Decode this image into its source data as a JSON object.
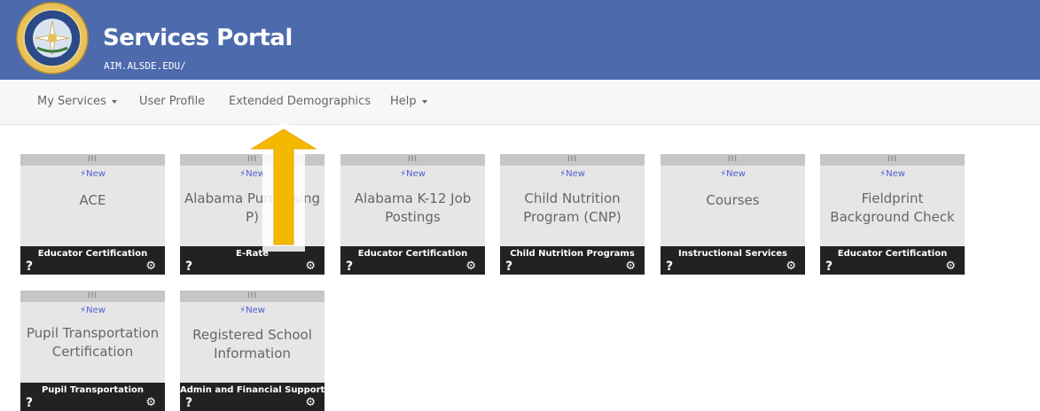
{
  "header": {
    "title": "Services Portal",
    "subtitle": "AIM.ALSDE.EDU/",
    "logo_icon": "alabama-state-department-of-education-seal",
    "bg_color": "#4d6aad"
  },
  "nav": {
    "items": [
      {
        "label": "My Services",
        "dropdown": true
      },
      {
        "label": "User Profile",
        "dropdown": false
      },
      {
        "label": "Extended Demographics",
        "dropdown": false
      },
      {
        "label": "Help",
        "dropdown": true
      }
    ]
  },
  "tiles": [
    {
      "handle": "III",
      "new_label": "New",
      "name": "ACE",
      "category": "Educator Certification",
      "help": "?",
      "gear_icon": "gear-icon"
    },
    {
      "handle": "III",
      "new_label": "New",
      "name": "Alabama Purchasing P)",
      "category": "E-Rate",
      "help": "?",
      "gear_icon": "gear-icon"
    },
    {
      "handle": "III",
      "new_label": "New",
      "name": "Alabama K-12 Job Postings",
      "category": "Educator Certification",
      "help": "?",
      "gear_icon": "gear-icon"
    },
    {
      "handle": "III",
      "new_label": "New",
      "name": "Child Nutrition Program (CNP)",
      "category": "Child Nutrition Programs",
      "help": "?",
      "gear_icon": "gear-icon"
    },
    {
      "handle": "III",
      "new_label": "New",
      "name": "Courses",
      "category": "Instructional Services",
      "help": "?",
      "gear_icon": "gear-icon"
    },
    {
      "handle": "III",
      "new_label": "New",
      "name": "Fieldprint Background Check",
      "category": "Educator Certification",
      "help": "?",
      "gear_icon": "gear-icon"
    },
    {
      "handle": "III",
      "new_label": "New",
      "name": "Pupil Transportation Certification",
      "category": "Pupil Transportation",
      "help": "?",
      "gear_icon": "gear-icon"
    },
    {
      "handle": "III",
      "new_label": "New",
      "name": "Registered School Information",
      "category": "Admin and Financial Support",
      "help": "?",
      "gear_icon": "gear-icon"
    }
  ],
  "annotation": {
    "arrow_color": "#f5b800",
    "arrow_icon": "up-arrow-callout"
  }
}
